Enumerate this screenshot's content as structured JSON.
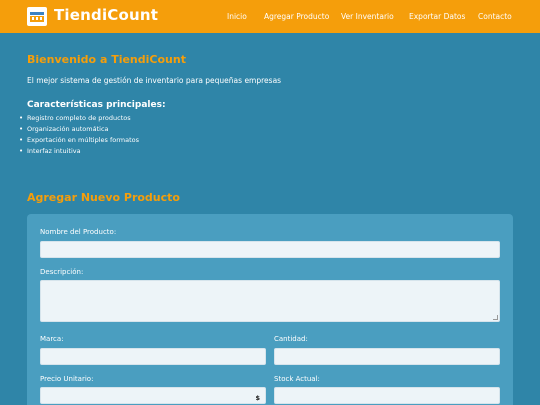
{
  "header": {
    "brand": "TiendiCount",
    "nav": [
      "Inicio",
      "Agregar Producto",
      "Ver Inventario",
      "Exportar Datos",
      "Contacto"
    ]
  },
  "welcome": {
    "title": "Bienvenido a TiendiCount",
    "subtitle": "El mejor sistema de gestión de inventario para pequeñas empresas",
    "features_title": "Características principales:",
    "features": [
      "Registro completo de productos",
      "Organización automática",
      "Exportación en múltiples formatos",
      "Interfaz intuitiva"
    ]
  },
  "form": {
    "title": "Agregar Nuevo Producto",
    "labels": {
      "name": "Nombre del Producto:",
      "description": "Descripción:",
      "brand": "Marca:",
      "quantity": "Cantidad:",
      "unit_price": "Precio Unitario:",
      "stock": "Stock Actual:"
    },
    "currency_symbol": "$"
  },
  "colors": {
    "background": "#2f85a8",
    "header": "#f59e0b",
    "accent_text": "#f59e0b",
    "card": "#4a9ec0"
  }
}
